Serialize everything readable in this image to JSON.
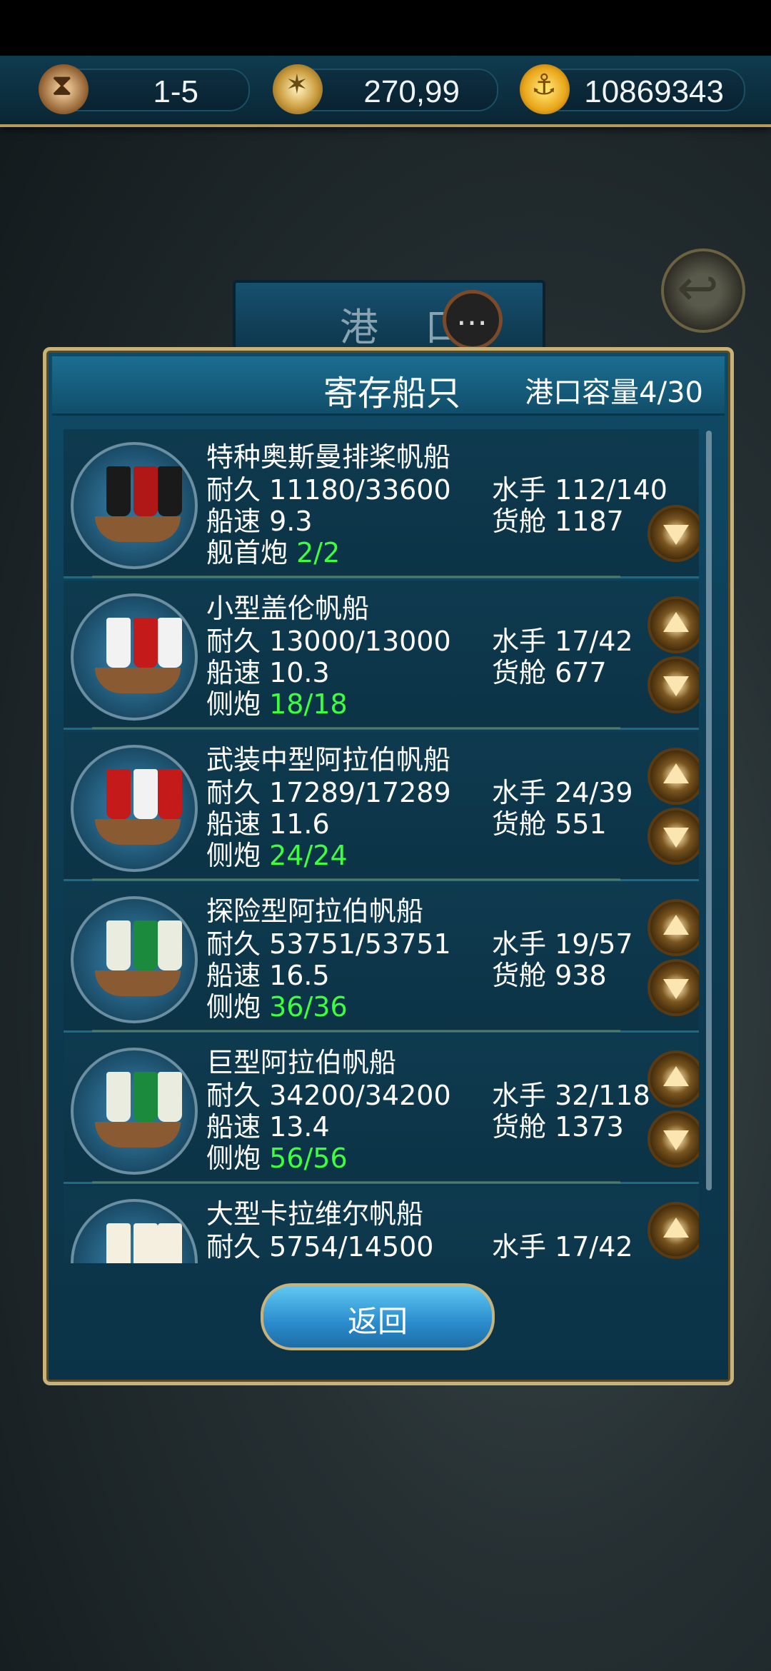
{
  "topbar": {
    "turn": "1-5",
    "coords": "270,99",
    "gold": "10869343"
  },
  "header": {
    "port_title": "港 口"
  },
  "panel": {
    "title": "寄存船只",
    "capacity_label": "港口容量",
    "capacity_value": "4/30"
  },
  "ships": [
    {
      "name": "特种奥斯曼排桨帆船",
      "durability": "耐久 11180/33600",
      "speed": "船速 9.3",
      "gun_label": "舰首炮",
      "gun_value": "2/2",
      "crew": "水手 112/140",
      "cargo_label": "货舱",
      "cargo_value": "1187",
      "sail_colors": [
        "#1a1a1a",
        "#b01818",
        "#1a1a1a"
      ]
    },
    {
      "name": "小型盖伦帆船",
      "durability": "耐久 13000/13000",
      "speed": "船速 10.3",
      "gun_label": "侧炮",
      "gun_value": "18/18",
      "crew": "水手 17/42",
      "cargo_label": "货舱",
      "cargo_value": "677",
      "sail_colors": [
        "#f2f2f2",
        "#c41a1a",
        "#f2f2f2"
      ]
    },
    {
      "name": "武装中型阿拉伯帆船",
      "durability": "耐久 17289/17289",
      "speed": "船速 11.6",
      "gun_label": "侧炮",
      "gun_value": "24/24",
      "crew": "水手 24/39",
      "cargo_label": "货舱",
      "cargo_value": "551",
      "sail_colors": [
        "#c41a1a",
        "#f2f2f2",
        "#c41a1a"
      ]
    },
    {
      "name": "探险型阿拉伯帆船",
      "durability": "耐久 53751/53751",
      "speed": "船速 16.5",
      "gun_label": "侧炮",
      "gun_value": "36/36",
      "crew": "水手 19/57",
      "cargo_label": "货舱",
      "cargo_value": "938",
      "sail_colors": [
        "#e9ecdf",
        "#1c8a3c",
        "#e9ecdf"
      ]
    },
    {
      "name": "巨型阿拉伯帆船",
      "durability": "耐久 34200/34200",
      "speed": "船速 13.4",
      "gun_label": "侧炮",
      "gun_value": "56/56",
      "crew": "水手 32/118",
      "cargo_label": "货舱",
      "cargo_value": "1373",
      "sail_colors": [
        "#e9ecdf",
        "#1c8a3c",
        "#e9ecdf"
      ]
    },
    {
      "name": "大型卡拉维尔帆船",
      "durability": "耐久 5754/14500",
      "speed": "",
      "gun_label": "",
      "gun_value": "",
      "crew": "水手 17/42",
      "cargo_label": "",
      "cargo_value": "",
      "sail_colors": [
        "#f5efe0",
        "#f5efe0",
        "#f5efe0"
      ]
    }
  ],
  "buttons": {
    "return_label": "返回"
  }
}
